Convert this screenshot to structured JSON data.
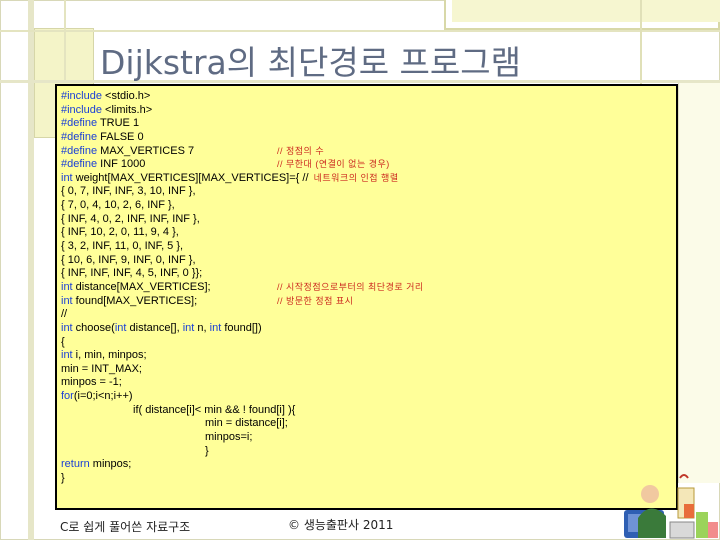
{
  "slide": {
    "title": "Dijkstra의 최단경로 프로그램"
  },
  "code": {
    "lines": [
      {
        "kw": "#include",
        "text": " <stdio.h>",
        "comment": ""
      },
      {
        "kw": "#include",
        "text": " <limits.h>",
        "comment": ""
      },
      {
        "kw": "#define",
        "text": " TRUE 1",
        "comment": ""
      },
      {
        "kw": "#define",
        "text": " FALSE 0",
        "comment": ""
      },
      {
        "kw": "#define",
        "text": " MAX_VERTICES 7",
        "comment": "// 정점의 수"
      },
      {
        "kw": "#define",
        "text": " INF 1000",
        "comment": "// 무한대 (연결이 없는 경우)"
      },
      {
        "kw": "int",
        "text": " weight[MAX_VERTICES][MAX_VERTICES]={ //",
        "comment": ""
      },
      {
        "kw": "",
        "text": "{ 0, 7, INF, INF, 3, 10, INF },",
        "comment": ""
      },
      {
        "kw": "",
        "text": "{ 7, 0, 4, 10, 2, 6, INF },",
        "comment": ""
      },
      {
        "kw": "",
        "text": "{ INF, 4, 0, 2, INF, INF, INF },",
        "comment": ""
      },
      {
        "kw": "",
        "text": "{ INF, 10, 2, 0, 11, 9, 4 },",
        "comment": ""
      },
      {
        "kw": "",
        "text": "{ 3, 2, INF, 11, 0, INF, 5 },",
        "comment": ""
      },
      {
        "kw": "",
        "text": "{ 10, 6, INF, 9, INF, 0, INF },",
        "comment": ""
      },
      {
        "kw": "",
        "text": "{ INF, INF, INF, 4, 5, INF, 0 }};",
        "comment": ""
      },
      {
        "kw": "int",
        "text": " distance[MAX_VERTICES];",
        "comment": "// 시작정점으로부터의 최단경로 거리"
      },
      {
        "kw": "int",
        "text": " found[MAX_VERTICES];",
        "comment": "// 방문한 정점 표시"
      },
      {
        "kw": "",
        "text": "//",
        "comment": ""
      },
      {
        "kw": "int",
        "text": " choose(",
        "comment": ""
      },
      {
        "kw": "",
        "text": "{",
        "comment": ""
      },
      {
        "kw": "int",
        "text": " i, min, minpos;",
        "comment": ""
      },
      {
        "kw": "",
        "text": "min = INT_MAX;",
        "comment": ""
      },
      {
        "kw": "",
        "text": "minpos = -1;",
        "comment": ""
      },
      {
        "kw": "for",
        "text": "(i=0;i<n;i++)",
        "comment": ""
      },
      {
        "kw": "",
        "text": "if( distance[i]< min && ! found[i] ){",
        "comment": ""
      },
      {
        "kw": "",
        "text": "min = distance[i];",
        "comment": ""
      },
      {
        "kw": "",
        "text": "minpos=i;",
        "comment": ""
      },
      {
        "kw": "",
        "text": "}",
        "comment": ""
      },
      {
        "kw": "return",
        "text": " minpos;",
        "comment": ""
      },
      {
        "kw": "",
        "text": "}",
        "comment": ""
      }
    ],
    "weight_comment": "네트워크의 인접 행렬",
    "choose_params": {
      "int1": "int",
      "p1": " distance[], ",
      "int2": "int",
      "p2": " n, ",
      "int3": "int",
      "p3": " found[])"
    }
  },
  "footer": {
    "left": "C로 쉽게 풀어쓴 자료구조",
    "center": "© 생능출판사 2011"
  },
  "colors": {
    "code_background": "#ffff99",
    "keyword": "#1a3fd6",
    "comment": "#cc2a1f",
    "title": "#5f6b83"
  }
}
